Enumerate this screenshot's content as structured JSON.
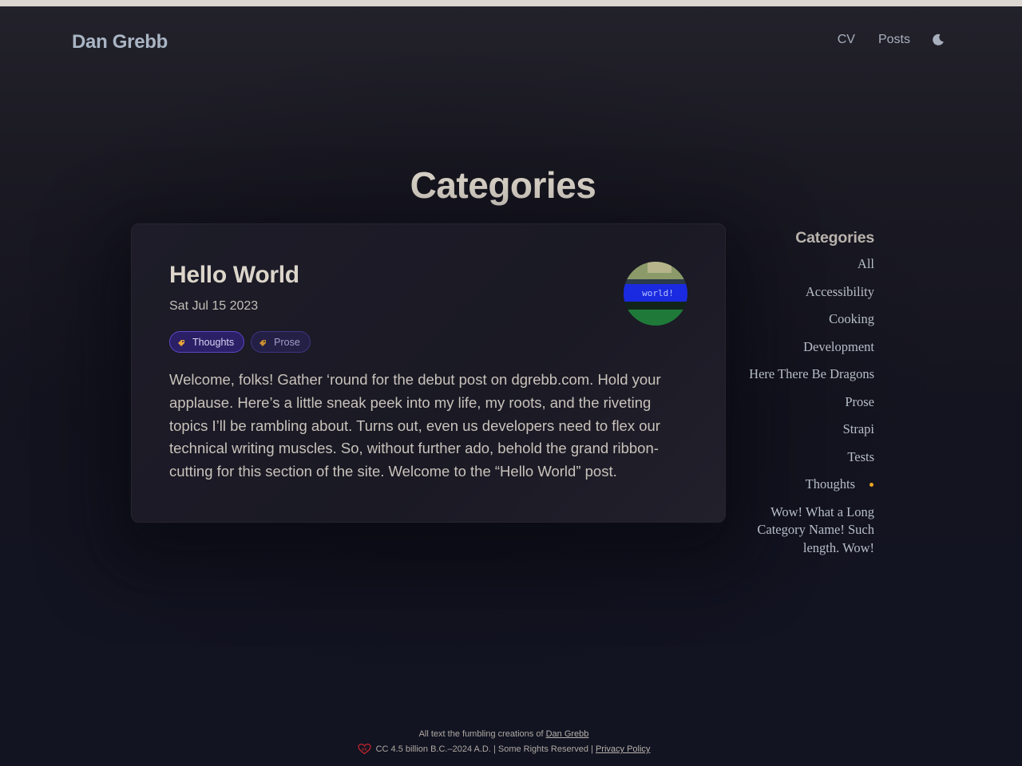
{
  "site": {
    "name": "Dan Grebb"
  },
  "nav": {
    "items": [
      {
        "label": "CV"
      },
      {
        "label": "Posts"
      }
    ],
    "theme_toggle_icon": "moon-icon"
  },
  "page": {
    "title": "Categories"
  },
  "post": {
    "title": "Hello World",
    "date": "Sat Jul 15 2023",
    "tags": [
      {
        "label": "Thoughts",
        "icon": "tag-icon"
      },
      {
        "label": "Prose",
        "icon": "tag-icon"
      }
    ],
    "thumbnail_text": "world!",
    "excerpt": "Welcome, folks! Gather ‘round for the debut post on dgrebb.com. Hold your applause. Here’s a little sneak peek into my life, my roots, and the riveting topics I’ll be rambling about. Turns out, even us developers need to flex our technical writing muscles. So, without further ado, behold the grand ribbon-cutting for this section of the site. Welcome to the “Hello World” post."
  },
  "sidebar": {
    "heading": "Categories",
    "items": [
      {
        "label": "All"
      },
      {
        "label": "Accessibility"
      },
      {
        "label": "Cooking"
      },
      {
        "label": "Development"
      },
      {
        "label": "Here There Be Dragons"
      },
      {
        "label": "Prose"
      },
      {
        "label": "Strapi"
      },
      {
        "label": "Tests"
      },
      {
        "label": "Thoughts"
      },
      {
        "label": "Wow! What a Long Category Name! Such length. Wow!"
      }
    ],
    "active_item": "Thoughts"
  },
  "footer": {
    "line1_text": "All text the fumbling creations of",
    "line1_link": "Dan Grebb",
    "line2_text": "CC 4.5 billion B.C.–2024 A.D. | Some Rights Reserved |",
    "line2_link": "Privacy Policy",
    "license_icon": "creative-commons-icon"
  },
  "colors": {
    "accent_dot": "#e9a420",
    "tag_primary_bg": "#2b1f66",
    "tag_icon": "#e6a33a",
    "title": "#dcd5ca"
  }
}
